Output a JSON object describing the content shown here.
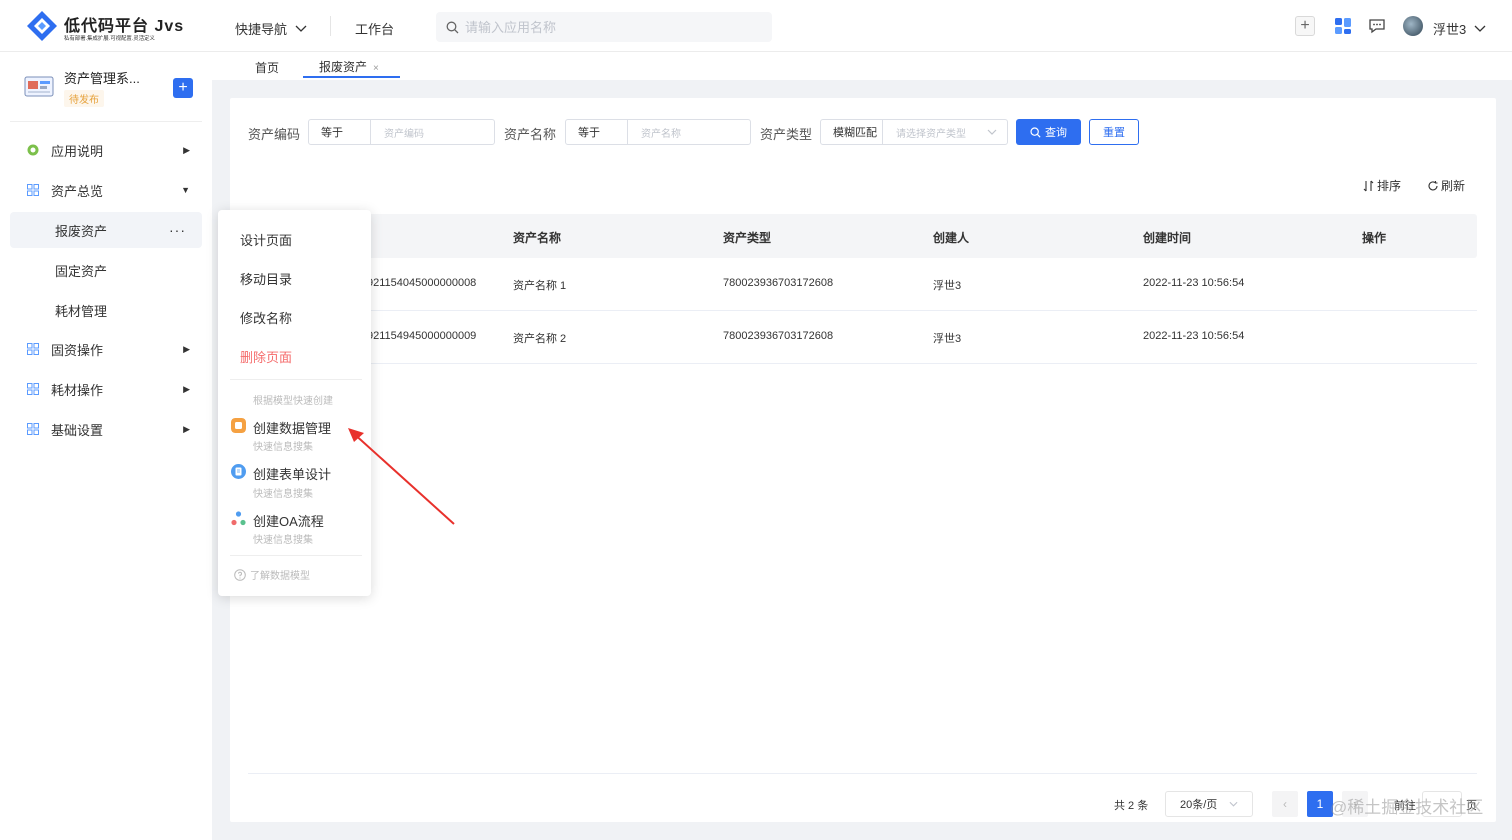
{
  "header": {
    "logo_title": "低代码平台 Jvs",
    "logo_subtitle": "私有部署.集成扩展.可视配置.灵活定义",
    "nav_quick": "快捷导航",
    "nav_workbench": "工作台",
    "search_placeholder": "请输入应用名称",
    "username": "浮世3"
  },
  "sidebar": {
    "app_name": "资产管理系...",
    "app_status": "待发布",
    "items": [
      {
        "label": "应用说明"
      },
      {
        "label": "资产总览"
      },
      {
        "label": "报废资产"
      },
      {
        "label": "固定资产"
      },
      {
        "label": "耗材管理"
      },
      {
        "label": "固资操作"
      },
      {
        "label": "耗材操作"
      },
      {
        "label": "基础设置"
      }
    ],
    "more": "···"
  },
  "tabs": [
    {
      "label": "首页"
    },
    {
      "label": "报废资产"
    }
  ],
  "tab_close": "×",
  "filters": {
    "code_label": "资产编码",
    "code_op": "等于",
    "code_placeholder": "资产编码",
    "name_label": "资产名称",
    "name_op": "等于",
    "name_placeholder": "资产名称",
    "type_label": "资产类型",
    "type_op": "模糊匹配",
    "type_placeholder": "请选择资产类型",
    "query": "查询",
    "reset": "重置"
  },
  "toolbar": {
    "sort": "排序",
    "refresh": "刷新"
  },
  "table": {
    "columns": [
      "资产名称",
      "资产类型",
      "创建人",
      "创建时间",
      "操作"
    ],
    "rows": [
      {
        "code": "921154045000000008",
        "name": "资产名称 1",
        "type": "780023936703172608",
        "creator": "浮世3",
        "time": "2022-11-23 10:56:54"
      },
      {
        "code": "921154945000000009",
        "name": "资产名称 2",
        "type": "780023936703172608",
        "creator": "浮世3",
        "time": "2022-11-23 10:56:54"
      }
    ]
  },
  "pagination": {
    "total": "共 2 条",
    "page_size": "20条/页",
    "current": "1",
    "prev": "‹",
    "next": "›",
    "goto": "前往",
    "page_unit": "页"
  },
  "context_menu": {
    "design": "设计页面",
    "move": "移动目录",
    "rename": "修改名称",
    "delete": "删除页面",
    "hint": "根据模型快速创建",
    "create_data": "创建数据管理",
    "create_form": "创建表单设计",
    "create_oa": "创建OA流程",
    "quick_collect": "快速信息搜集",
    "learn": "了解数据模型"
  },
  "watermark": "@稀土掘金技术社区",
  "colors": {
    "primary": "#2e6ef0",
    "danger": "#f56c6c",
    "warning": "#e6a23c"
  }
}
